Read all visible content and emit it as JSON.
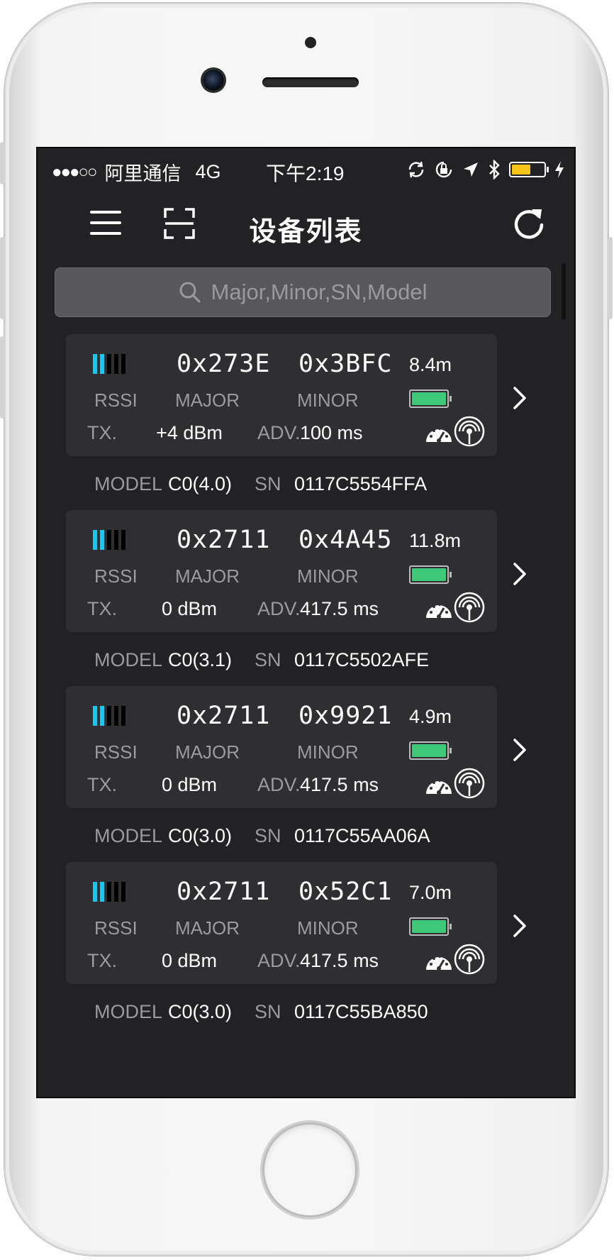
{
  "status_bar": {
    "signal": "●●●○○",
    "carrier": "阿里通信",
    "network": "4G",
    "time": "下午2:19"
  },
  "nav": {
    "title": "设备列表"
  },
  "search": {
    "placeholder": "Major,Minor,SN,Model"
  },
  "labels": {
    "rssi": "RSSI",
    "major": "MAJOR",
    "minor": "MINOR",
    "tx": "TX.",
    "adv": "ADV.",
    "model": "MODEL",
    "sn": "SN"
  },
  "devices": [
    {
      "major": "0x273E",
      "minor": "0x3BFC",
      "distance": "8.4m",
      "tx": "+4 dBm",
      "adv": "100 ms",
      "model": "C0(4.0)",
      "sn": "0117C5554FFA",
      "rssi_level": 2,
      "battery_level": 1.0
    },
    {
      "major": "0x2711",
      "minor": "0x4A45",
      "distance": "11.8m",
      "tx": "0 dBm",
      "adv": "417.5 ms",
      "model": "C0(3.1)",
      "sn": "0117C5502AFE",
      "rssi_level": 2,
      "battery_level": 1.0
    },
    {
      "major": "0x2711",
      "minor": "0x9921",
      "distance": "4.9m",
      "tx": "0 dBm",
      "adv": "417.5 ms",
      "model": "C0(3.0)",
      "sn": "0117C55AA06A",
      "rssi_level": 2,
      "battery_level": 1.0
    },
    {
      "major": "0x2711",
      "minor": "0x52C1",
      "distance": "7.0m",
      "tx": "0 dBm",
      "adv": "417.5 ms",
      "model": "C0(3.0)",
      "sn": "0117C55BA850",
      "rssi_level": 2,
      "battery_level": 1.0
    }
  ],
  "icons": {
    "menu": "hamburger-menu-icon",
    "scan": "scan-icon",
    "refresh": "refresh-icon",
    "search": "search-icon",
    "battery": "battery-icon",
    "gauge": "gauge-icon",
    "broadcast": "broadcast-icon",
    "chevron": "chevron-right-icon"
  },
  "colors": {
    "screen_bg": "#222224",
    "card_bg": "#2f2f32",
    "rssi_active": "#17c8f0",
    "battery_fill": "#3ec97a",
    "status_battery": "#f5c518"
  }
}
